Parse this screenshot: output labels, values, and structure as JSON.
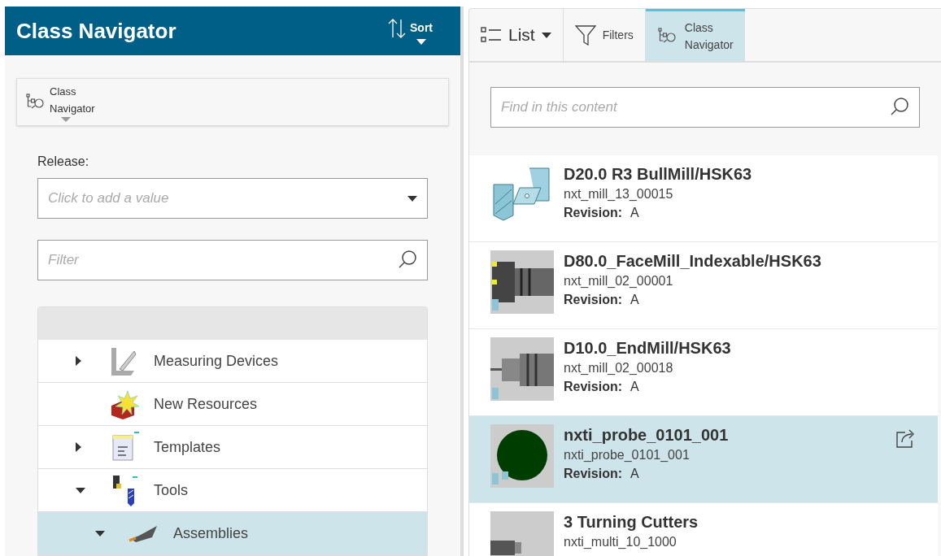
{
  "left_panel": {
    "title": "Class Navigator",
    "sort_button": "Sort",
    "navigator_tab": {
      "line_1": "Class",
      "line_2": "Navigator"
    },
    "release": {
      "label": "Release:",
      "placeholder": "Click to add a value"
    },
    "filter": {
      "placeholder": "Filter"
    },
    "tree": [
      {
        "label": "Measuring Devices",
        "kind": "measure",
        "expanded": false,
        "selected": false
      },
      {
        "label": "New Resources",
        "kind": "new",
        "selected": false
      },
      {
        "label": "Templates",
        "kind": "template",
        "expanded": false,
        "selected": false
      },
      {
        "label": "Tools",
        "kind": "tools",
        "expanded": true,
        "selected": false,
        "children": [
          {
            "label": "Assemblies",
            "kind": "assembly",
            "expanded": true,
            "selected": true
          }
        ]
      }
    ]
  },
  "right_panel": {
    "toolbar": [
      {
        "kind": "list",
        "label": "List",
        "selected": false
      },
      {
        "kind": "filters",
        "label": "Filters",
        "selected": false
      },
      {
        "kind": "navigator",
        "line_1": "Class",
        "line_2": "Navigator",
        "selected": true
      }
    ],
    "search": {
      "placeholder": "Find in this content"
    },
    "items": [
      {
        "kind": "drill",
        "title": "D20.0 R3 BullMill/HSK63",
        "id": "nxt_mill_13_00015",
        "revision_label": "Revision:",
        "revision": "A",
        "selected": false
      },
      {
        "kind": "facemill",
        "title": "D80.0_FaceMill_Indexable/HSK63",
        "id": "nxt_mill_02_00001",
        "revision_label": "Revision:",
        "revision": "A",
        "selected": false
      },
      {
        "kind": "endmill",
        "title": "D10.0_EndMill/HSK63",
        "id": "nxt_mill_02_00018",
        "revision_label": "Revision:",
        "revision": "A",
        "selected": false
      },
      {
        "kind": "probe",
        "title": "nxti_probe_0101_001",
        "id": "nxti_probe_0101_001",
        "revision_label": "Revision:",
        "revision": "A",
        "selected": true
      },
      {
        "kind": "turning",
        "title": "3 Turning Cutters",
        "id": "nxti_multi_10_1000",
        "selected": false
      }
    ]
  }
}
